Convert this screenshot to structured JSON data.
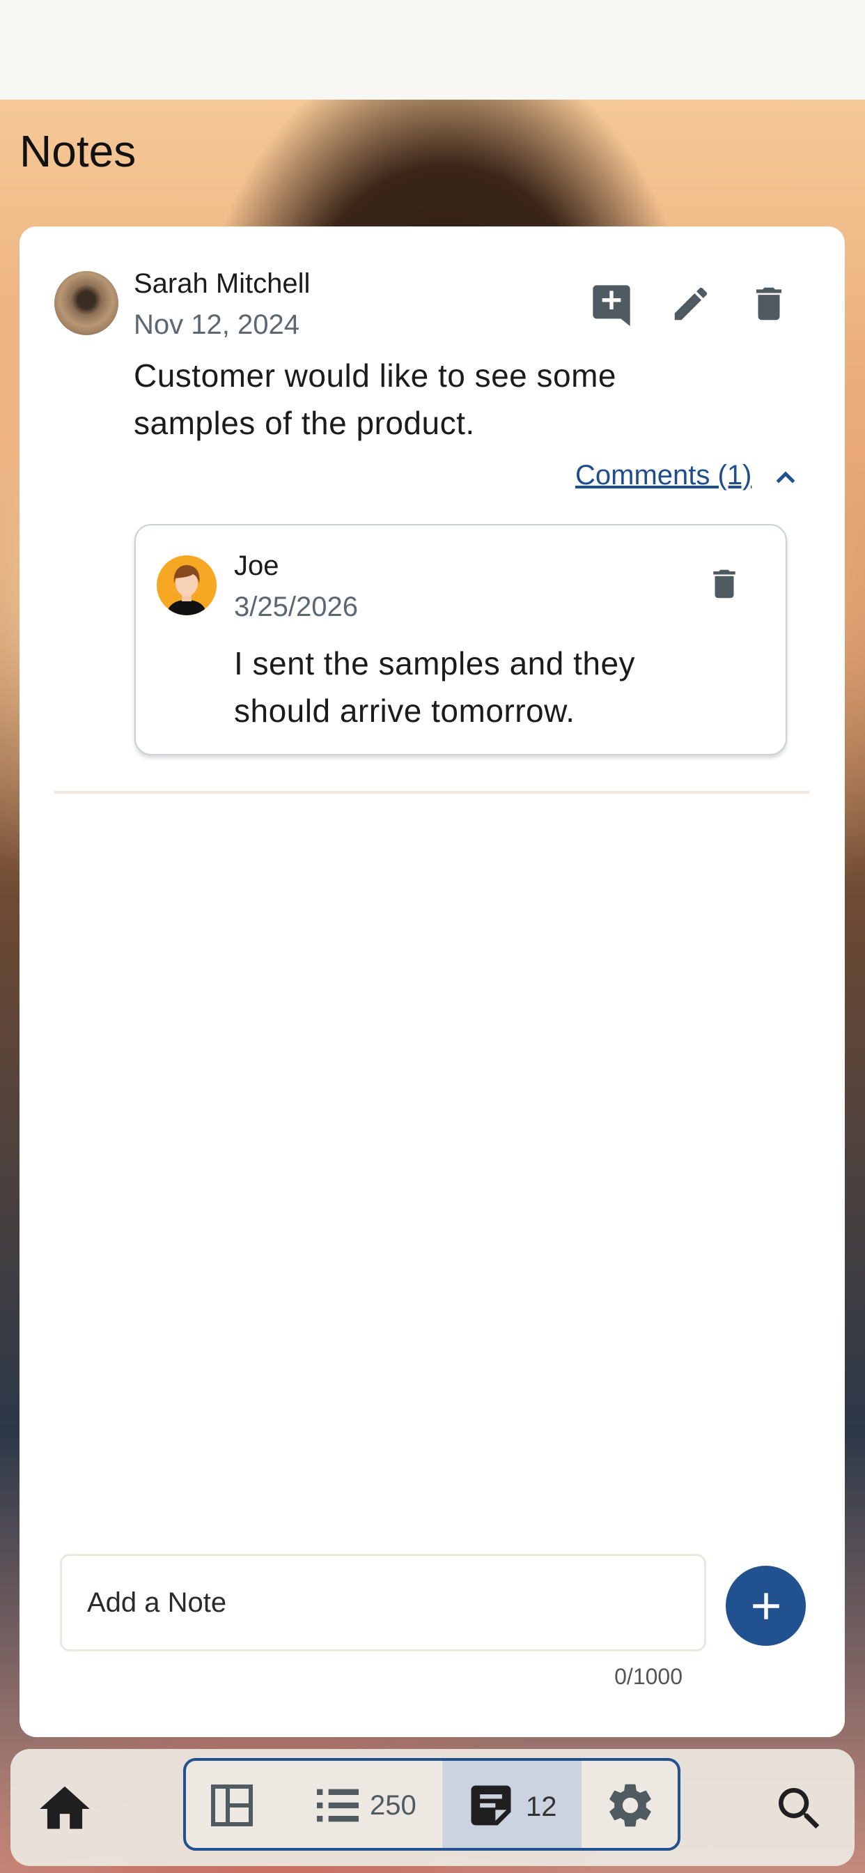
{
  "page": {
    "title": "Notes"
  },
  "note": {
    "author": "Sarah Mitchell",
    "date": "Nov 12, 2024",
    "text": "Customer would like to see some samples of the product.",
    "comments_toggle": "Comments (1)"
  },
  "comment": {
    "author": "Joe",
    "date": "3/25/2026",
    "text": "I sent the samples and they should arrive tomorrow."
  },
  "composer": {
    "placeholder": "Add a Note",
    "char_count": "0/1000"
  },
  "bottom_nav": {
    "list_count": "250",
    "notes_count": "12"
  },
  "colors": {
    "accent": "#22518f",
    "link": "#1f4e8c",
    "icon": "#505a61"
  }
}
